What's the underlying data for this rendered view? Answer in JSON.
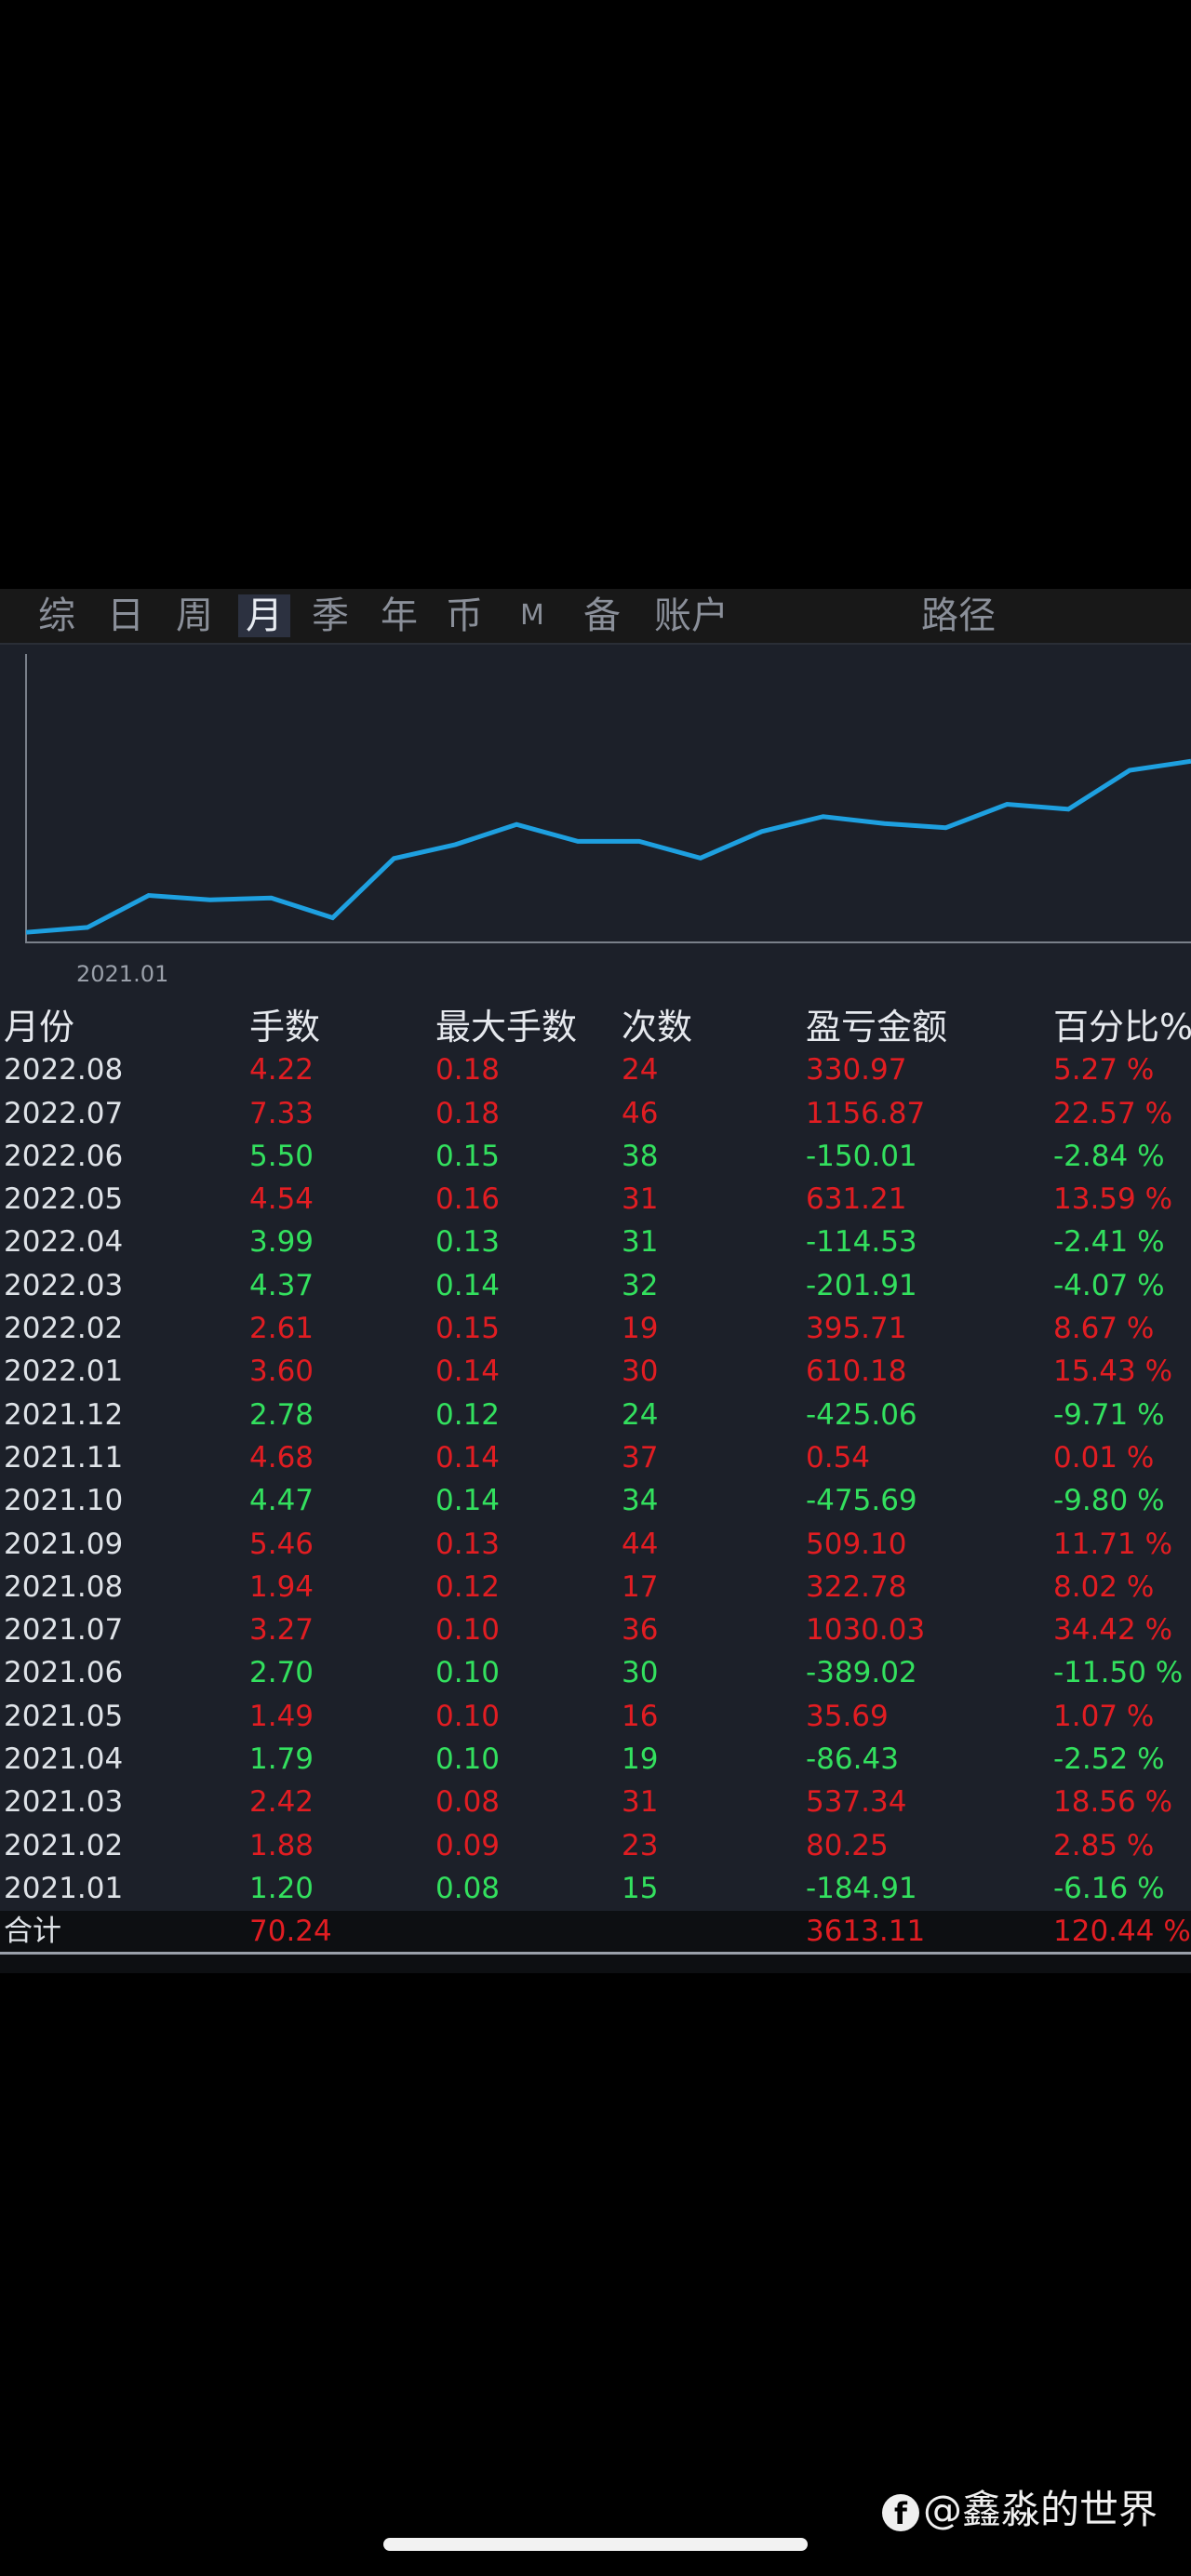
{
  "tabs": [
    {
      "label": "综",
      "active": false
    },
    {
      "label": "日",
      "active": false
    },
    {
      "label": "周",
      "active": false
    },
    {
      "label": "月",
      "active": true
    },
    {
      "label": "季",
      "active": false
    },
    {
      "label": "年",
      "active": false
    },
    {
      "label": "币",
      "active": false
    },
    {
      "label": "M",
      "active": false
    },
    {
      "label": "备",
      "active": false
    },
    {
      "label": "账户",
      "active": false
    }
  ],
  "path_label": "路径",
  "chart_data": {
    "type": "line",
    "xlabel_tick": "2021.01",
    "series_color": "#1ea0e0",
    "x": [
      "2021.01",
      "2021.02",
      "2021.03",
      "2021.04",
      "2021.05",
      "2021.06",
      "2021.07",
      "2021.08",
      "2021.09",
      "2021.10",
      "2021.11",
      "2021.12",
      "2022.01",
      "2022.02",
      "2022.03",
      "2022.04",
      "2022.05",
      "2022.06",
      "2022.07",
      "2022.08"
    ],
    "y_note": "cumulative equity shape",
    "y": [
      -6.16,
      -3.31,
      15.25,
      12.73,
      13.8,
      2.3,
      36.72,
      44.74,
      56.45,
      46.65,
      46.66,
      36.95,
      52.38,
      61.05,
      56.98,
      54.57,
      68.16,
      65.32,
      87.89,
      93.16
    ]
  },
  "table": {
    "headers": [
      "月份",
      "手数",
      "最大手数",
      "次数",
      "盈亏金额",
      "百分比%"
    ],
    "rows": [
      [
        "2022.08",
        "4.22",
        "0.18",
        "24",
        "330.97",
        "5.27 %"
      ],
      [
        "2022.07",
        "7.33",
        "0.18",
        "46",
        "1156.87",
        "22.57 %"
      ],
      [
        "2022.06",
        "5.50",
        "0.15",
        "38",
        "-150.01",
        "-2.84 %"
      ],
      [
        "2022.05",
        "4.54",
        "0.16",
        "31",
        "631.21",
        "13.59 %"
      ],
      [
        "2022.04",
        "3.99",
        "0.13",
        "31",
        "-114.53",
        "-2.41 %"
      ],
      [
        "2022.03",
        "4.37",
        "0.14",
        "32",
        "-201.91",
        "-4.07 %"
      ],
      [
        "2022.02",
        "2.61",
        "0.15",
        "19",
        "395.71",
        "8.67 %"
      ],
      [
        "2022.01",
        "3.60",
        "0.14",
        "30",
        "610.18",
        "15.43 %"
      ],
      [
        "2021.12",
        "2.78",
        "0.12",
        "24",
        "-425.06",
        "-9.71 %"
      ],
      [
        "2021.11",
        "4.68",
        "0.14",
        "37",
        "0.54",
        "0.01 %"
      ],
      [
        "2021.10",
        "4.47",
        "0.14",
        "34",
        "-475.69",
        "-9.80 %"
      ],
      [
        "2021.09",
        "5.46",
        "0.13",
        "44",
        "509.10",
        "11.71 %"
      ],
      [
        "2021.08",
        "1.94",
        "0.12",
        "17",
        "322.78",
        "8.02 %"
      ],
      [
        "2021.07",
        "3.27",
        "0.10",
        "36",
        "1030.03",
        "34.42 %"
      ],
      [
        "2021.06",
        "2.70",
        "0.10",
        "30",
        "-389.02",
        "-11.50 %"
      ],
      [
        "2021.05",
        "1.49",
        "0.10",
        "16",
        "35.69",
        "1.07 %"
      ],
      [
        "2021.04",
        "1.79",
        "0.10",
        "19",
        "-86.43",
        "-2.52 %"
      ],
      [
        "2021.03",
        "2.42",
        "0.08",
        "31",
        "537.34",
        "18.56 %"
      ],
      [
        "2021.02",
        "1.88",
        "0.09",
        "23",
        "80.25",
        "2.85 %"
      ],
      [
        "2021.01",
        "1.20",
        "0.08",
        "15",
        "-184.91",
        "-6.16 %"
      ]
    ],
    "total": {
      "label": "合计",
      "lots": "70.24",
      "pnl": "3613.11",
      "pct": "120.44 %"
    }
  },
  "colors": {
    "profit": "#e11d22",
    "loss": "#33e05e",
    "line": "#1ea0e0"
  },
  "watermark": {
    "icon": "facebook-icon",
    "text": "@鑫淼的世界"
  }
}
